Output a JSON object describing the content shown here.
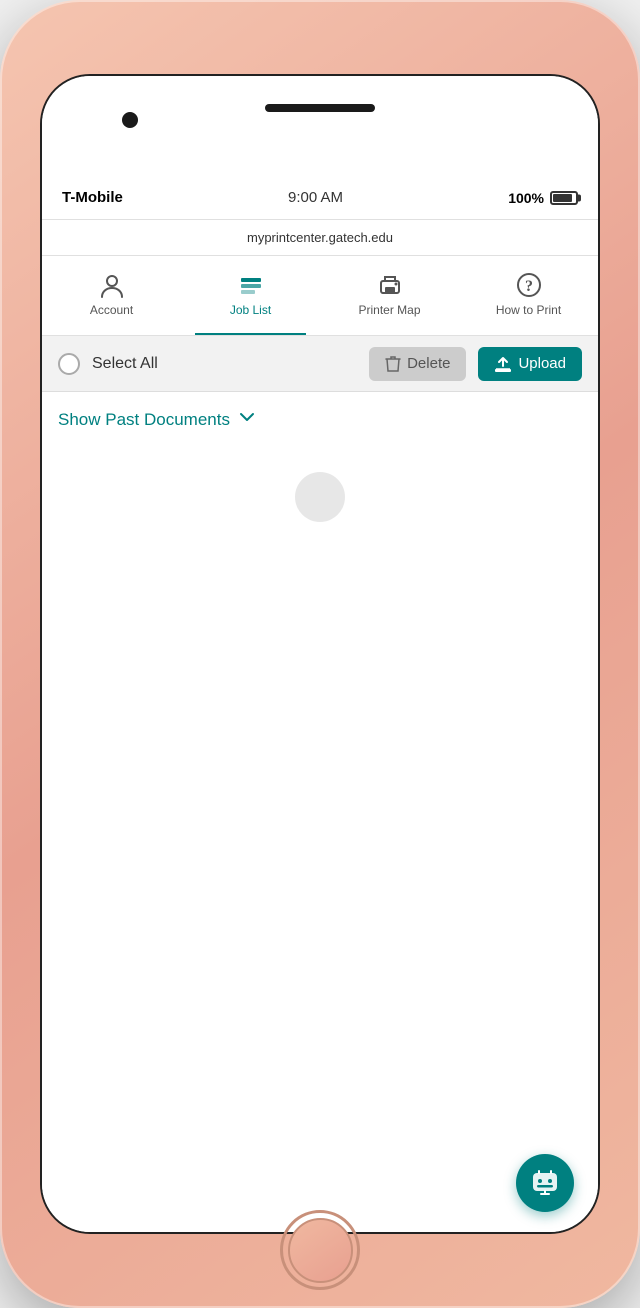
{
  "statusBar": {
    "carrier": "T-Mobile",
    "time": "9:00 AM",
    "battery": "100%",
    "url": "myprintcenter.gatech.edu"
  },
  "navTabs": [
    {
      "id": "account",
      "label": "Account",
      "active": false
    },
    {
      "id": "job-list",
      "label": "Job List",
      "active": true
    },
    {
      "id": "printer-map",
      "label": "Printer Map",
      "active": false
    },
    {
      "id": "how-to-print",
      "label": "How to Print",
      "active": false
    }
  ],
  "actionBar": {
    "selectAllLabel": "Select All",
    "deleteLabel": "Delete",
    "uploadLabel": "Upload"
  },
  "content": {
    "showPastDocsLabel": "Show Past Documents"
  }
}
